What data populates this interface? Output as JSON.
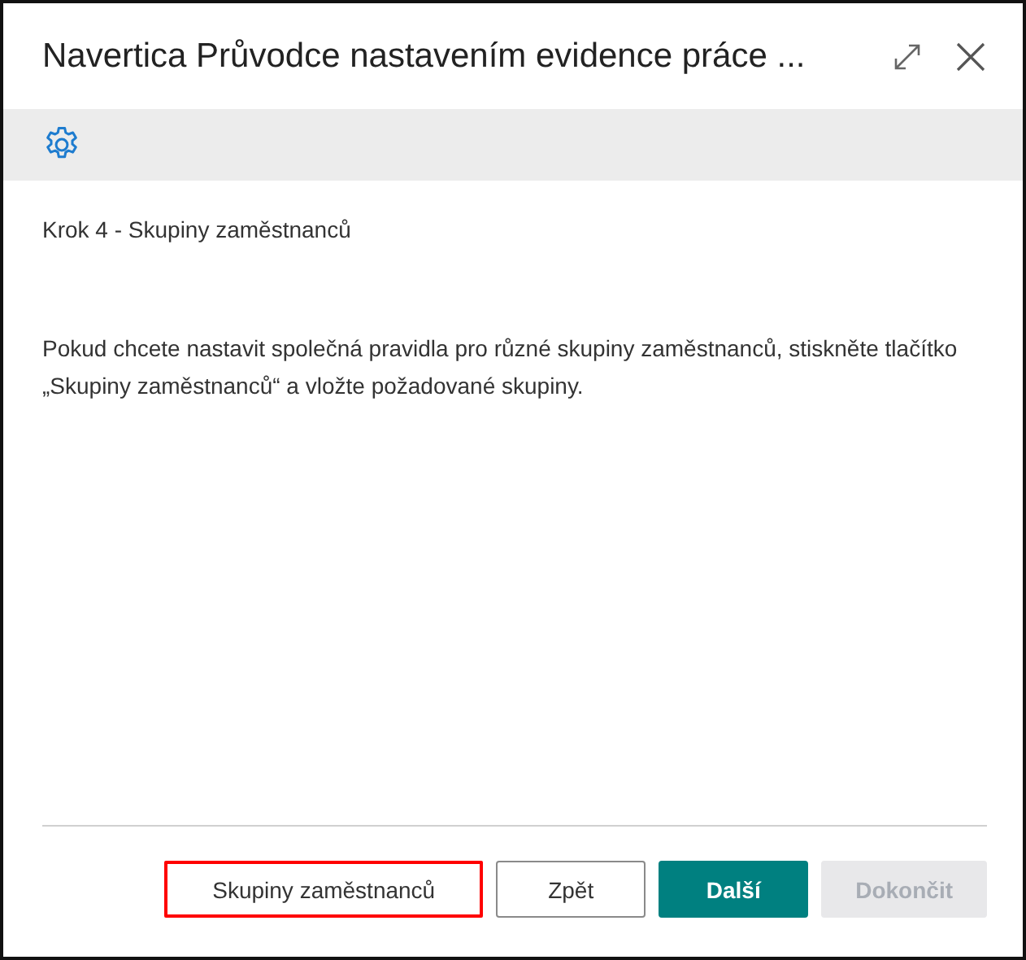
{
  "window": {
    "title": "Navertica Průvodce nastavením evidence práce ..."
  },
  "step_title": "Krok 4 - Skupiny zaměstnanců",
  "description": "Pokud chcete nastavit společná pravidla pro různé skupiny zaměstnanců, stiskněte tlačítko „Skupiny zaměstnanců“ a vložte požadované skupiny.",
  "buttons": [
    {
      "label": "Skupiny zaměstnanců",
      "kind": "default",
      "disabled": false,
      "highlighted": true
    },
    {
      "label": "Zpět",
      "kind": "default",
      "disabled": false,
      "highlighted": false
    },
    {
      "label": "Další",
      "kind": "primary",
      "disabled": false,
      "highlighted": false
    },
    {
      "label": "Dokončit",
      "kind": "primary",
      "disabled": true,
      "highlighted": false
    }
  ]
}
